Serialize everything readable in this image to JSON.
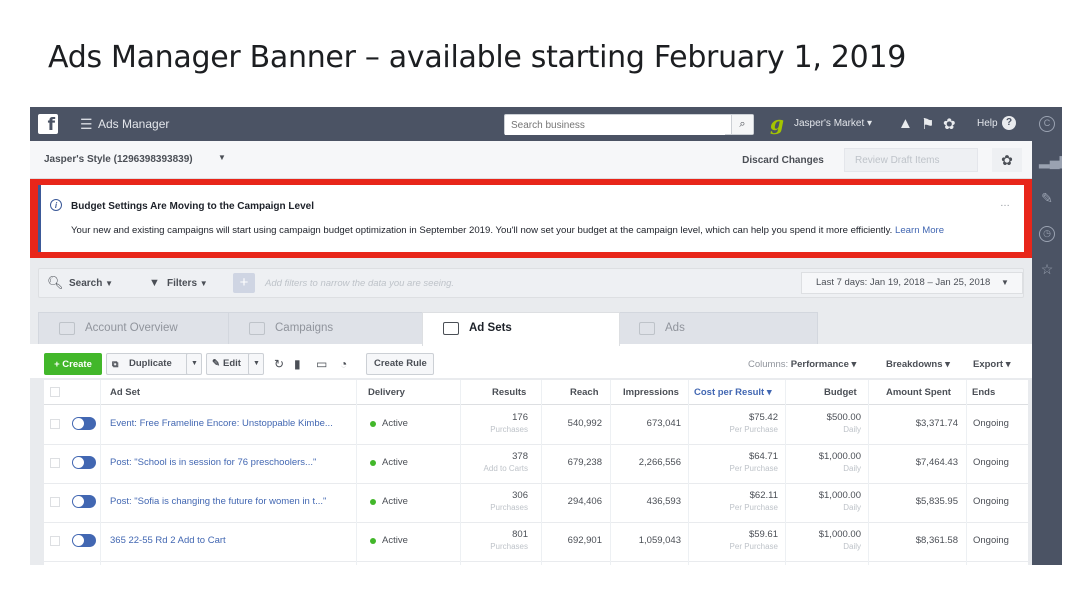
{
  "slide_title": "Ads Manager Banner – available starting February 1, 2019",
  "topbar": {
    "logo": "f",
    "app_name": "Ads Manager",
    "search_placeholder": "Search business",
    "account_menu": "Jasper's Market  ▾",
    "help": "Help"
  },
  "account_row": {
    "account_name": "Jasper's Style (1296398393839)",
    "discard_label": "Discard Changes",
    "review_label": "Review Draft Items"
  },
  "banner": {
    "title": "Budget Settings Are Moving to the Campaign Level",
    "message": "Your new and existing campaigns will start using campaign budget optimization in September 2019. You'll now set your budget at the campaign level, which can help you spend it more efficiently.",
    "link": "Learn More",
    "dots": "…"
  },
  "filterbar": {
    "search_label": "Search",
    "filters_label": "Filters",
    "placeholder": "Add filters to narrow the data you are seeing.",
    "date_range": "Last 7 days: Jan 19, 2018 – Jan 25, 2018"
  },
  "tabs": [
    {
      "label": "Account Overview"
    },
    {
      "label": "Campaigns"
    },
    {
      "label": "Ad Sets"
    },
    {
      "label": "Ads"
    }
  ],
  "toolbar": {
    "create": "+ Create",
    "duplicate": "Duplicate",
    "edit": "Edit",
    "create_rule": "Create Rule",
    "columns_prefix": "Columns:",
    "columns_value": "Performance ▾",
    "breakdowns": "Breakdowns ▾",
    "export": "Export ▾"
  },
  "table": {
    "headers": [
      "Ad Set",
      "Delivery",
      "Results",
      "Reach",
      "Impressions",
      "Cost per Result ▾",
      "Budget",
      "Amount Spent",
      "Ends"
    ],
    "rows": [
      {
        "name": "Event: Free Frameline Encore: Unstoppable Kimbe...",
        "delivery": "Active",
        "results": "176",
        "results_sub": "Purchases",
        "reach": "540,992",
        "impressions": "673,041",
        "cost": "$75.42",
        "cost_sub": "Per Purchase",
        "budget": "$500.00",
        "budget_sub": "Daily",
        "spent": "$3,371.74",
        "ends": "Ongoing"
      },
      {
        "name": "Post: \"School is in session for 76 preschoolers...\"",
        "delivery": "Active",
        "results": "378",
        "results_sub": "Add to Carts",
        "reach": "679,238",
        "impressions": "2,266,556",
        "cost": "$64.71",
        "cost_sub": "Per Purchase",
        "budget": "$1,000.00",
        "budget_sub": "Daily",
        "spent": "$7,464.43",
        "ends": "Ongoing"
      },
      {
        "name": "Post: \"Sofia is changing the future for women in t...\"",
        "delivery": "Active",
        "results": "306",
        "results_sub": "Purchases",
        "reach": "294,406",
        "impressions": "436,593",
        "cost": "$62.11",
        "cost_sub": "Per Purchase",
        "budget": "$1,000.00",
        "budget_sub": "Daily",
        "spent": "$5,835.95",
        "ends": "Ongoing"
      },
      {
        "name": "365 22-55 Rd 2 Add to Cart",
        "delivery": "Active",
        "results": "801",
        "results_sub": "Purchases",
        "reach": "692,901",
        "impressions": "1,059,043",
        "cost": "$59.61",
        "cost_sub": "Per Purchase",
        "budget": "$1,000.00",
        "budget_sub": "Daily",
        "spent": "$8,361.58",
        "ends": "Ongoing"
      }
    ]
  },
  "colors": {
    "topbar": "#4b5364",
    "banner_outline": "#e8261a",
    "link": "#4267b2",
    "create_green": "#42b72a"
  }
}
